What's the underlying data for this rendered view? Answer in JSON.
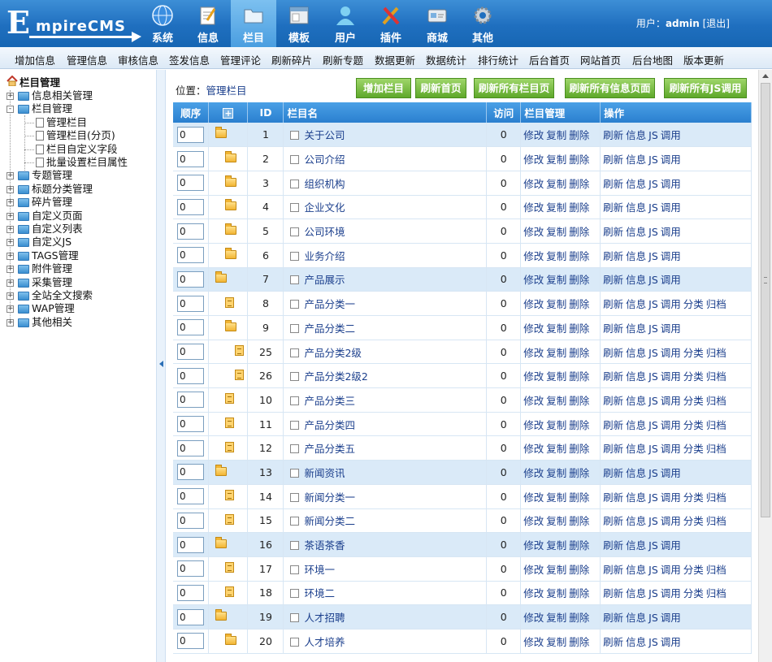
{
  "header": {
    "logo_big": "E",
    "logo_rest": "mpireCMS",
    "nav": [
      {
        "label": "系统",
        "icon": "globe-icon"
      },
      {
        "label": "信息",
        "icon": "notepad-icon"
      },
      {
        "label": "栏目",
        "icon": "folder-icon"
      },
      {
        "label": "模板",
        "icon": "window-icon"
      },
      {
        "label": "用户",
        "icon": "user-icon"
      },
      {
        "label": "插件",
        "icon": "tools-icon"
      },
      {
        "label": "商城",
        "icon": "card-icon"
      },
      {
        "label": "其他",
        "icon": "gear-icon"
      }
    ],
    "active_nav": "栏目",
    "user_prefix": "用户：",
    "user_name": "admin",
    "logout": "[退出]"
  },
  "subnav": [
    "增加信息",
    "管理信息",
    "审核信息",
    "签发信息",
    "管理评论",
    "刷新碎片",
    "刷新专题",
    "数据更新",
    "数据统计",
    "排行统计",
    "后台首页",
    "网站首页",
    "后台地图",
    "版本更新"
  ],
  "tree": {
    "root": "栏目管理",
    "items": [
      {
        "label": "信息相关管理",
        "box": "+"
      },
      {
        "label": "栏目管理",
        "box": "-"
      },
      {
        "label": "管理栏目",
        "child": true
      },
      {
        "label": "管理栏目(分页)",
        "child": true
      },
      {
        "label": "栏目自定义字段",
        "child": true
      },
      {
        "label": "批量设置栏目属性",
        "child": true
      },
      {
        "label": "专题管理",
        "box": "+"
      },
      {
        "label": "标题分类管理",
        "box": "+"
      },
      {
        "label": "碎片管理",
        "box": "+"
      },
      {
        "label": "自定义页面",
        "box": "+"
      },
      {
        "label": "自定义列表",
        "box": "+"
      },
      {
        "label": "自定义JS",
        "box": "+"
      },
      {
        "label": "TAGS管理",
        "box": "+"
      },
      {
        "label": "附件管理",
        "box": "+"
      },
      {
        "label": "采集管理",
        "box": "+"
      },
      {
        "label": "全站全文搜索",
        "box": "+"
      },
      {
        "label": "WAP管理",
        "box": "+"
      },
      {
        "label": "其他相关",
        "box": "+"
      }
    ]
  },
  "main": {
    "location_prefix": "位置：",
    "location_link": "管理栏目",
    "buttons": [
      "增加栏目",
      "刷新首页",
      "刷新所有栏目页",
      "刷新所有信息页面",
      "刷新所有JS调用"
    ],
    "columns": [
      "顺序",
      "+",
      "ID",
      "栏目名",
      "访问",
      "栏目管理",
      "操作"
    ],
    "rows": [
      {
        "order": "0",
        "icon": "folder",
        "indent": 0,
        "id": "1",
        "name": "关于公司",
        "visits": "0",
        "top": true,
        "ops2": [
          "刷新",
          "信息",
          "JS",
          "调用"
        ]
      },
      {
        "order": "0",
        "icon": "folder",
        "indent": 1,
        "id": "2",
        "name": "公司介绍",
        "visits": "0",
        "top": false,
        "ops2": [
          "刷新",
          "信息",
          "JS",
          "调用"
        ]
      },
      {
        "order": "0",
        "icon": "folder",
        "indent": 1,
        "id": "3",
        "name": "组织机构",
        "visits": "0",
        "top": false,
        "ops2": [
          "刷新",
          "信息",
          "JS",
          "调用"
        ]
      },
      {
        "order": "0",
        "icon": "folder",
        "indent": 1,
        "id": "4",
        "name": "企业文化",
        "visits": "0",
        "top": false,
        "ops2": [
          "刷新",
          "信息",
          "JS",
          "调用"
        ]
      },
      {
        "order": "0",
        "icon": "folder",
        "indent": 1,
        "id": "5",
        "name": "公司环境",
        "visits": "0",
        "top": false,
        "ops2": [
          "刷新",
          "信息",
          "JS",
          "调用"
        ]
      },
      {
        "order": "0",
        "icon": "folder",
        "indent": 1,
        "id": "6",
        "name": "业务介绍",
        "visits": "0",
        "top": false,
        "ops2": [
          "刷新",
          "信息",
          "JS",
          "调用"
        ]
      },
      {
        "order": "0",
        "icon": "folder",
        "indent": 0,
        "id": "7",
        "name": "产品展示",
        "visits": "0",
        "top": true,
        "ops2": [
          "刷新",
          "信息",
          "JS",
          "调用"
        ]
      },
      {
        "order": "0",
        "icon": "page",
        "indent": 1,
        "id": "8",
        "name": "产品分类一",
        "visits": "0",
        "top": false,
        "ops2": [
          "刷新",
          "信息",
          "JS",
          "调用",
          "分类",
          "归档"
        ]
      },
      {
        "order": "0",
        "icon": "folder",
        "indent": 1,
        "id": "9",
        "name": "产品分类二",
        "visits": "0",
        "top": false,
        "ops2": [
          "刷新",
          "信息",
          "JS",
          "调用"
        ]
      },
      {
        "order": "0",
        "icon": "page",
        "indent": 2,
        "id": "25",
        "name": "产品分类2级",
        "visits": "0",
        "top": false,
        "ops2": [
          "刷新",
          "信息",
          "JS",
          "调用",
          "分类",
          "归档"
        ]
      },
      {
        "order": "0",
        "icon": "page",
        "indent": 2,
        "id": "26",
        "name": "产品分类2级2",
        "visits": "0",
        "top": false,
        "ops2": [
          "刷新",
          "信息",
          "JS",
          "调用",
          "分类",
          "归档"
        ]
      },
      {
        "order": "0",
        "icon": "page",
        "indent": 1,
        "id": "10",
        "name": "产品分类三",
        "visits": "0",
        "top": false,
        "ops2": [
          "刷新",
          "信息",
          "JS",
          "调用",
          "分类",
          "归档"
        ]
      },
      {
        "order": "0",
        "icon": "page",
        "indent": 1,
        "id": "11",
        "name": "产品分类四",
        "visits": "0",
        "top": false,
        "ops2": [
          "刷新",
          "信息",
          "JS",
          "调用",
          "分类",
          "归档"
        ]
      },
      {
        "order": "0",
        "icon": "page",
        "indent": 1,
        "id": "12",
        "name": "产品分类五",
        "visits": "0",
        "top": false,
        "ops2": [
          "刷新",
          "信息",
          "JS",
          "调用",
          "分类",
          "归档"
        ]
      },
      {
        "order": "0",
        "icon": "folder",
        "indent": 0,
        "id": "13",
        "name": "新闻资讯",
        "visits": "0",
        "top": true,
        "ops2": [
          "刷新",
          "信息",
          "JS",
          "调用"
        ]
      },
      {
        "order": "0",
        "icon": "page",
        "indent": 1,
        "id": "14",
        "name": "新闻分类一",
        "visits": "0",
        "top": false,
        "ops2": [
          "刷新",
          "信息",
          "JS",
          "调用",
          "分类",
          "归档"
        ]
      },
      {
        "order": "0",
        "icon": "page",
        "indent": 1,
        "id": "15",
        "name": "新闻分类二",
        "visits": "0",
        "top": false,
        "ops2": [
          "刷新",
          "信息",
          "JS",
          "调用",
          "分类",
          "归档"
        ]
      },
      {
        "order": "0",
        "icon": "folder",
        "indent": 0,
        "id": "16",
        "name": "茶语茶香",
        "visits": "0",
        "top": true,
        "ops2": [
          "刷新",
          "信息",
          "JS",
          "调用"
        ]
      },
      {
        "order": "0",
        "icon": "page",
        "indent": 1,
        "id": "17",
        "name": "环境一",
        "visits": "0",
        "top": false,
        "ops2": [
          "刷新",
          "信息",
          "JS",
          "调用",
          "分类",
          "归档"
        ]
      },
      {
        "order": "0",
        "icon": "page",
        "indent": 1,
        "id": "18",
        "name": "环境二",
        "visits": "0",
        "top": false,
        "ops2": [
          "刷新",
          "信息",
          "JS",
          "调用",
          "分类",
          "归档"
        ]
      },
      {
        "order": "0",
        "icon": "folder",
        "indent": 0,
        "id": "19",
        "name": "人才招聘",
        "visits": "0",
        "top": true,
        "ops2": [
          "刷新",
          "信息",
          "JS",
          "调用"
        ]
      },
      {
        "order": "0",
        "icon": "folder",
        "indent": 1,
        "id": "20",
        "name": "人才培养",
        "visits": "0",
        "top": false,
        "ops2": [
          "刷新",
          "信息",
          "JS",
          "调用"
        ]
      }
    ],
    "ops1": [
      "修改",
      "复制",
      "删除"
    ]
  }
}
